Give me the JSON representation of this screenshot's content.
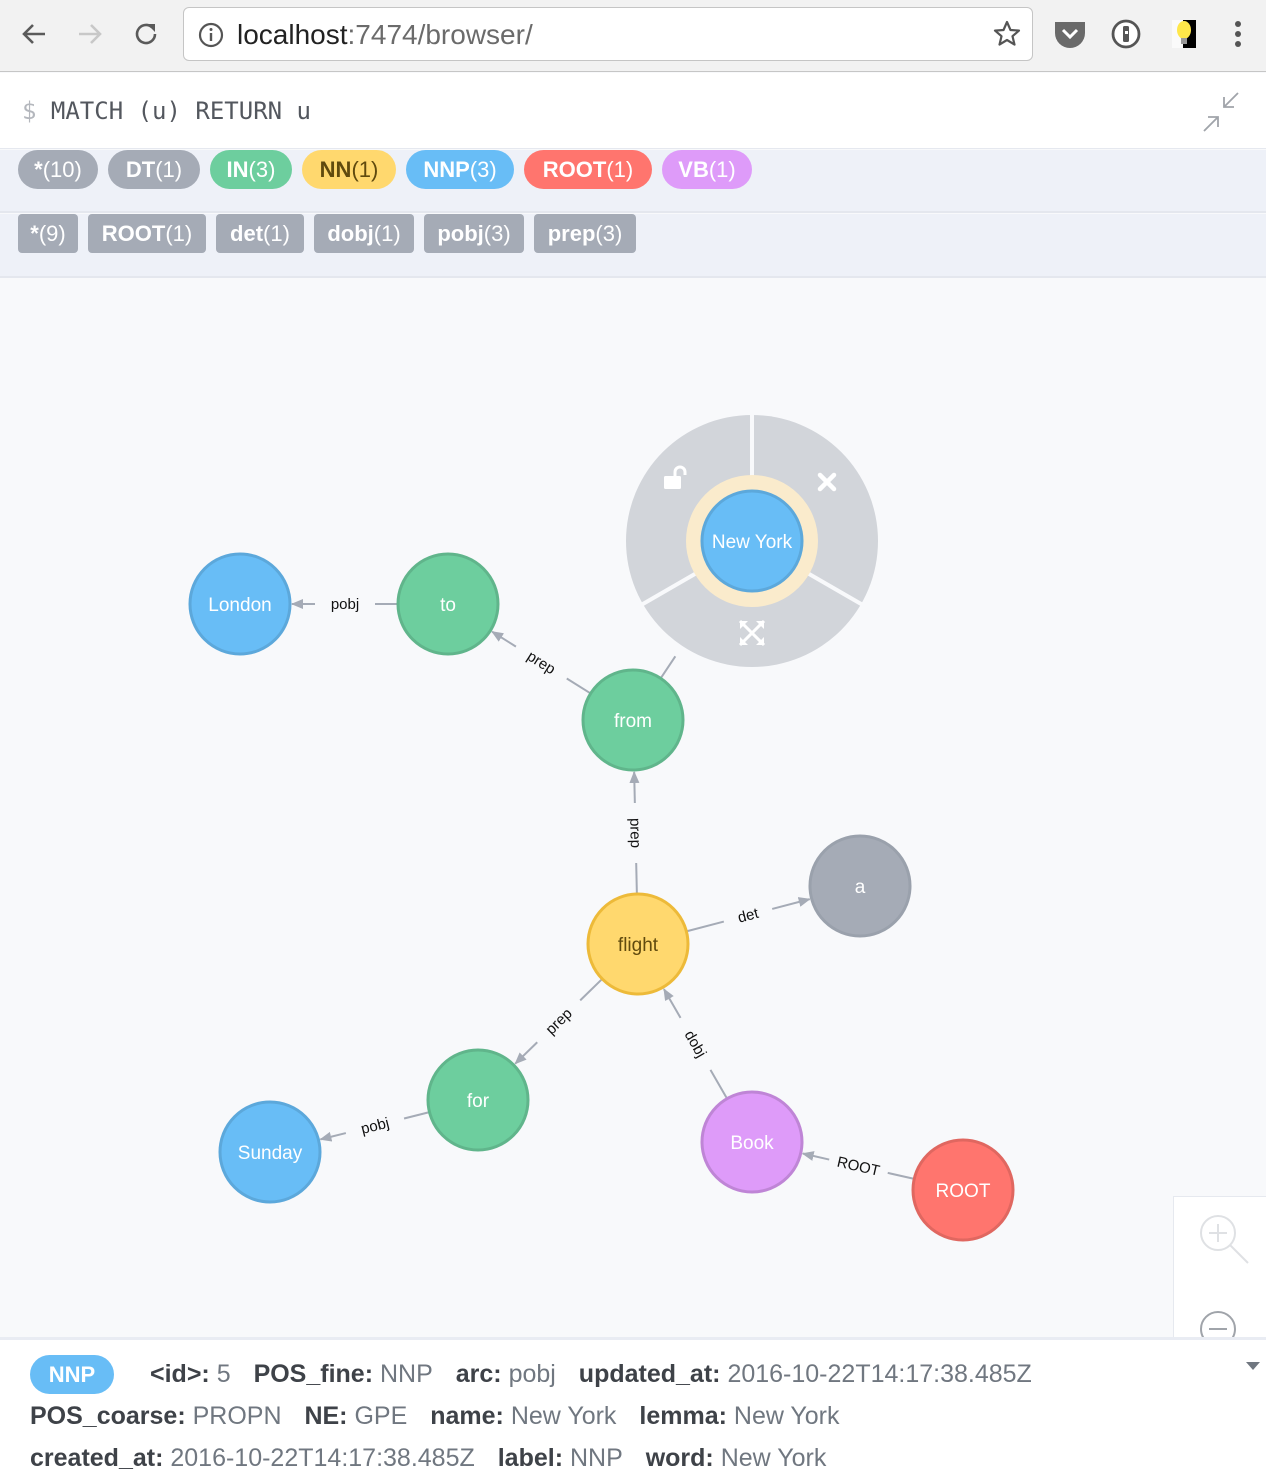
{
  "browser": {
    "url_host": "localhost",
    "url_rest": ":7474/browser/",
    "icons": [
      "back-icon",
      "forward-icon",
      "reload-icon",
      "info-icon",
      "star-icon",
      "pocket-icon",
      "1password-icon",
      "lightbulb-extension-icon",
      "menu-icon"
    ]
  },
  "editor": {
    "prompt_symbol": "$",
    "query": "MATCH (u) RETURN u"
  },
  "node_labels": [
    {
      "name": "*",
      "count": "(10)",
      "color": "#a5abb6",
      "text_color": "#ffffff"
    },
    {
      "name": "DT",
      "count": "(1)",
      "color": "#a5abb6",
      "text_color": "#ffffff"
    },
    {
      "name": "IN",
      "count": "(3)",
      "color": "#6dce9e",
      "text_color": "#ffffff"
    },
    {
      "name": "NN",
      "count": "(1)",
      "color": "#ffd86e",
      "text_color": "#604a0e"
    },
    {
      "name": "NNP",
      "count": "(3)",
      "color": "#68bdf6",
      "text_color": "#ffffff"
    },
    {
      "name": "ROOT",
      "count": "(1)",
      "color": "#ff756e",
      "text_color": "#ffffff"
    },
    {
      "name": "VB",
      "count": "(1)",
      "color": "#de9bf9",
      "text_color": "#ffffff"
    }
  ],
  "relationship_types": [
    {
      "name": "*",
      "count": "(9)"
    },
    {
      "name": "ROOT",
      "count": "(1)"
    },
    {
      "name": "det",
      "count": "(1)"
    },
    {
      "name": "dobj",
      "count": "(1)"
    },
    {
      "name": "pobj",
      "count": "(3)"
    },
    {
      "name": "prep",
      "count": "(3)"
    }
  ],
  "graph": {
    "nodes": [
      {
        "id": "newyork",
        "caption": "New York",
        "label": "NNP",
        "selected": true
      },
      {
        "id": "london",
        "caption": "London",
        "label": "NNP"
      },
      {
        "id": "to",
        "caption": "to",
        "label": "IN"
      },
      {
        "id": "from",
        "caption": "from",
        "label": "IN"
      },
      {
        "id": "flight",
        "caption": "flight",
        "label": "NN"
      },
      {
        "id": "a",
        "caption": "a",
        "label": "DT"
      },
      {
        "id": "for",
        "caption": "for",
        "label": "IN"
      },
      {
        "id": "sunday",
        "caption": "Sunday",
        "label": "NNP"
      },
      {
        "id": "book",
        "caption": "Book",
        "label": "VB"
      },
      {
        "id": "root",
        "caption": "ROOT",
        "label": "ROOT"
      }
    ],
    "relationships": [
      {
        "from": "to",
        "to": "london",
        "type": "pobj"
      },
      {
        "from": "from",
        "to": "to",
        "type": "prep"
      },
      {
        "from": "from",
        "to": "newyork",
        "type": "pobj"
      },
      {
        "from": "flight",
        "to": "from",
        "type": "prep"
      },
      {
        "from": "flight",
        "to": "a",
        "type": "det"
      },
      {
        "from": "flight",
        "to": "for",
        "type": "prep"
      },
      {
        "from": "for",
        "to": "sunday",
        "type": "pobj"
      },
      {
        "from": "book",
        "to": "flight",
        "type": "dobj"
      },
      {
        "from": "root",
        "to": "book",
        "type": "ROOT"
      }
    ],
    "ring_menu": [
      "unlock-icon",
      "remove-icon",
      "expand-icon"
    ]
  },
  "zoom_controls": [
    "zoom-in-icon",
    "zoom-out-icon"
  ],
  "inspector": {
    "badge": "NNP",
    "lines": [
      [
        {
          "key": "<id>:",
          "value": "5"
        },
        {
          "key": "POS_fine:",
          "value": "NNP"
        },
        {
          "key": "arc:",
          "value": "pobj"
        },
        {
          "key": "updated_at:",
          "value": "2016-10-22T14:17:38.485Z"
        }
      ],
      [
        {
          "key": "POS_coarse:",
          "value": "PROPN"
        },
        {
          "key": "NE:",
          "value": "GPE"
        },
        {
          "key": "name:",
          "value": "New York"
        },
        {
          "key": "lemma:",
          "value": "New York"
        }
      ],
      [
        {
          "key": "created_at:",
          "value": "2016-10-22T14:17:38.485Z"
        },
        {
          "key": "label:",
          "value": "NNP"
        },
        {
          "key": "word:",
          "value": "New York"
        }
      ]
    ]
  }
}
